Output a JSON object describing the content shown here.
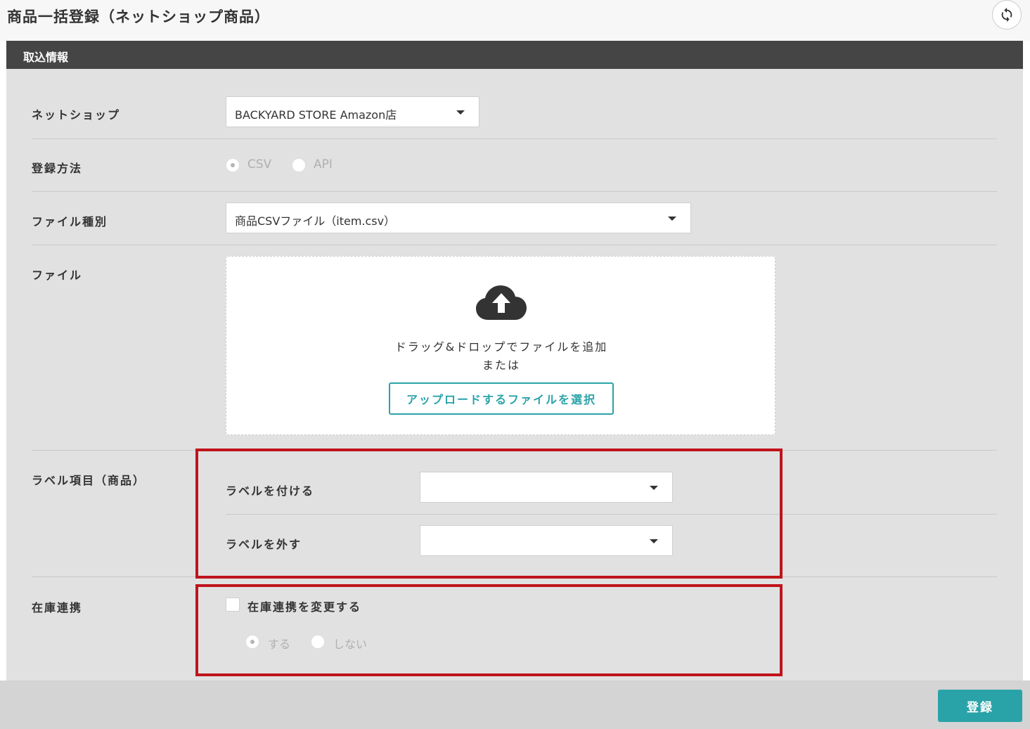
{
  "page": {
    "title": "商品一括登録（ネットショップ商品）"
  },
  "section": {
    "title": "取込情報"
  },
  "form": {
    "netshop": {
      "label": "ネットショップ",
      "value": "BACKYARD STORE Amazon店"
    },
    "method": {
      "label": "登録方法",
      "options": [
        "CSV",
        "API"
      ],
      "selected": "CSV"
    },
    "file_type": {
      "label": "ファイル種別",
      "value": "商品CSVファイル（item.csv）"
    },
    "file": {
      "label": "ファイル",
      "drop_text": "ドラッグ&ドロップでファイルを追加",
      "or_text": "または",
      "button_label": "アップロードするファイルを選択"
    },
    "labels": {
      "label": "ラベル項目（商品）",
      "add_label": "ラベルを付ける",
      "add_value": "",
      "remove_label": "ラベルを外す",
      "remove_value": ""
    },
    "stock": {
      "label": "在庫連携",
      "checkbox_label": "在庫連携を変更する",
      "options": [
        "する",
        "しない"
      ],
      "selected": "する"
    }
  },
  "footer": {
    "register_label": "登録"
  },
  "colors": {
    "accent": "#2aa3a8",
    "header_bg": "#454545",
    "highlight": "#c0141c"
  }
}
